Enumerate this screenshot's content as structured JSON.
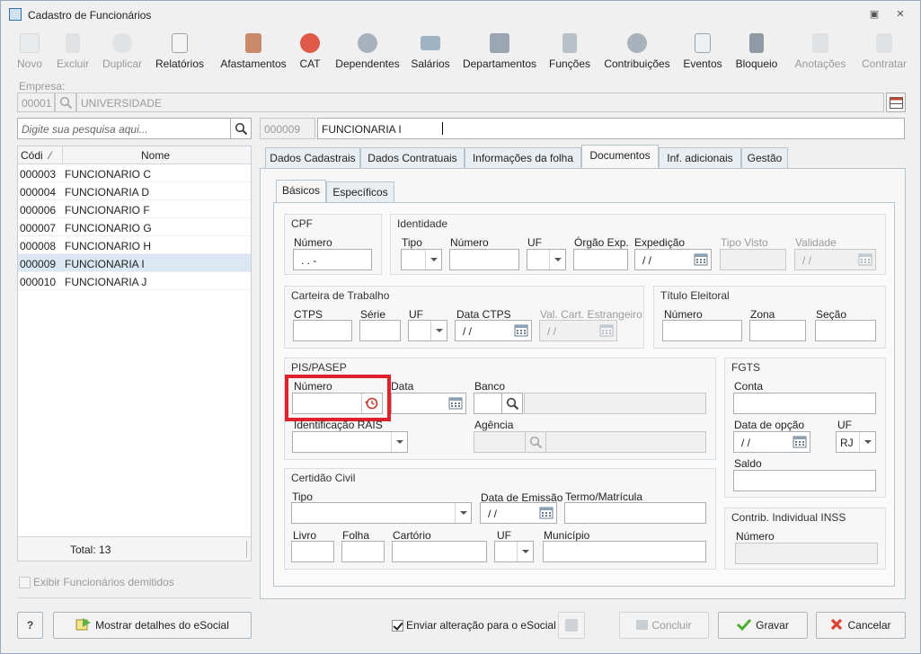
{
  "window": {
    "title": "Cadastro de Funcionários"
  },
  "toolbar": [
    {
      "label": "Novo",
      "icon": "new-document-icon",
      "enabled": false
    },
    {
      "label": "Excluir",
      "icon": "trash-icon",
      "enabled": false
    },
    {
      "label": "Duplicar",
      "icon": "users-duplicate-icon",
      "enabled": false
    },
    {
      "label": "Relatórios",
      "icon": "report-icon",
      "enabled": true
    },
    {
      "label": "Afastamentos",
      "icon": "house-leave-icon",
      "enabled": true
    },
    {
      "label": "CAT",
      "icon": "medical-cross-icon",
      "enabled": true
    },
    {
      "label": "Dependentes",
      "icon": "dependents-icon",
      "enabled": true
    },
    {
      "label": "Salários",
      "icon": "money-icon",
      "enabled": true
    },
    {
      "label": "Departamentos",
      "icon": "department-icon",
      "enabled": true
    },
    {
      "label": "Funções",
      "icon": "badge-icon",
      "enabled": true
    },
    {
      "label": "Contribuições",
      "icon": "contributions-icon",
      "enabled": true
    },
    {
      "label": "Eventos",
      "icon": "events-list-icon",
      "enabled": true
    },
    {
      "label": "Bloqueio",
      "icon": "lock-icon",
      "enabled": true
    },
    {
      "label": "Anotações",
      "icon": "notes-icon",
      "enabled": false
    },
    {
      "label": "Contratar",
      "icon": "hire-icon",
      "enabled": false
    }
  ],
  "empresa": {
    "label": "Empresa:",
    "code": "00001",
    "name": "UNIVERSIDADE"
  },
  "search": {
    "placeholder": "Digite sua pesquisa aqui..."
  },
  "current": {
    "code": "000009",
    "name": "FUNCIONARIA I"
  },
  "list": {
    "col_code": "Códi",
    "col_name": "Nome",
    "rows": [
      {
        "code": "000003",
        "name": "FUNCIONARIO C"
      },
      {
        "code": "000004",
        "name": "FUNCIONARIA D"
      },
      {
        "code": "000006",
        "name": "FUNCIONARIO F"
      },
      {
        "code": "000007",
        "name": "FUNCIONARIO G"
      },
      {
        "code": "000008",
        "name": "FUNCIONARIO H"
      },
      {
        "code": "000009",
        "name": "FUNCIONARIA I"
      },
      {
        "code": "000010",
        "name": "FUNCIONARIA J"
      }
    ],
    "selected_index": 5,
    "total": "Total: 13"
  },
  "show_dismissed": "Exibir Funcionários demitidos",
  "tabs": [
    "Dados Cadastrais",
    "Dados Contratuais",
    "Informações da folha",
    "Documentos",
    "Inf. adicionais",
    "Gestão"
  ],
  "active_tab": 3,
  "subtabs": [
    "Básicos",
    "Específicos"
  ],
  "cpf": {
    "title": "CPF",
    "numero_label": "Número",
    "numero_value": " .  .  -"
  },
  "identidade": {
    "title": "Identidade",
    "tipo": "Tipo",
    "numero": "Número",
    "uf": "UF",
    "orgao": "Órgão Exp.",
    "expedicao": "Expedição",
    "expedicao_value": " / /",
    "tipo_visto": "Tipo Visto",
    "validade": "Validade",
    "validade_value": " / /"
  },
  "ctps": {
    "title": "Carteira de Trabalho",
    "ctps": "CTPS",
    "serie": "Série",
    "uf": "UF",
    "data": "Data CTPS",
    "data_value": " / /",
    "val_cart": "Val. Cart. Estrangeiro",
    "val_cart_value": " / /"
  },
  "titulo": {
    "title": "Título Eleitoral",
    "numero": "Número",
    "zona": "Zona",
    "secao": "Seção"
  },
  "pis": {
    "title": "PIS/PASEP",
    "numero": "Número",
    "data": "Data",
    "banco": "Banco",
    "rais": "Identificação RAIS",
    "agencia": "Agência"
  },
  "fgts": {
    "title": "FGTS",
    "conta": "Conta",
    "data_opcao": "Data de opção",
    "data_value": " / /",
    "uf": "UF",
    "uf_value": "RJ",
    "saldo": "Saldo"
  },
  "certidao": {
    "title": "Certidão Civil",
    "tipo": "Tipo",
    "data_emissao": "Data de Emissão",
    "data_value": " / /",
    "termo": "Termo/Matrícula",
    "livro": "Livro",
    "folha": "Folha",
    "cartorio": "Cartório",
    "uf": "UF",
    "municipio": "Município"
  },
  "inss": {
    "title": "Contrib. Individual INSS",
    "numero": "Número"
  },
  "footer": {
    "help": "?",
    "esocial_details": "Mostrar detalhes do eSocial",
    "send_esocial": "Enviar alteração para o eSocial",
    "concluir": "Concluir",
    "gravar": "Gravar",
    "cancelar": "Cancelar"
  },
  "colors": {
    "highlight": "#e0202a",
    "selected_row": "#dbe8f4",
    "cancel_icon": "#d9432f",
    "ok_icon": "#4caf2f"
  }
}
